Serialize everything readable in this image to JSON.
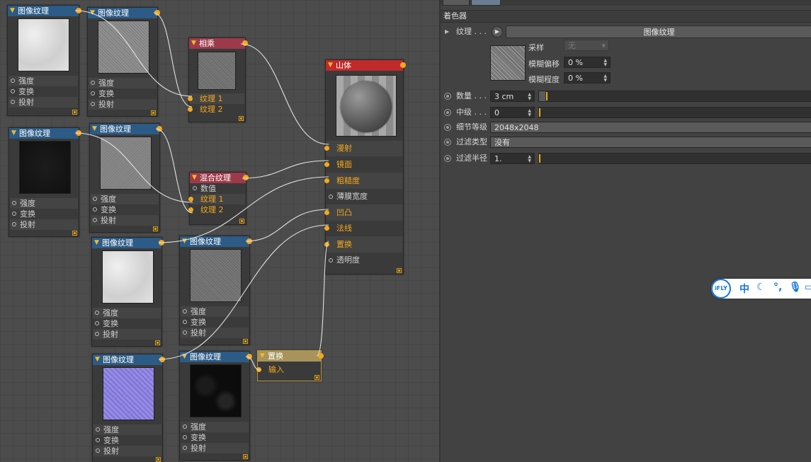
{
  "node_editor": {
    "nodes": {
      "tex_a": {
        "title": "图像纹理",
        "ports": [
          "强度",
          "变换",
          "投射"
        ]
      },
      "tex_b": {
        "title": "图像纹理",
        "ports": [
          "强度",
          "变换",
          "投射"
        ]
      },
      "multiply": {
        "title": "相乘",
        "ports": [
          "纹理 1",
          "纹理 2"
        ]
      },
      "tex_c": {
        "title": "图像纹理",
        "ports": [
          "强度",
          "变换",
          "投射"
        ]
      },
      "tex_d": {
        "title": "图像纹理",
        "ports": [
          "强度",
          "变换",
          "投射"
        ]
      },
      "mix": {
        "title": "混合纹理",
        "ports": [
          "数值",
          "纹理 1",
          "纹理 2"
        ]
      },
      "tex_e": {
        "title": "图像纹理",
        "ports": [
          "强度",
          "变换",
          "投射"
        ]
      },
      "tex_f": {
        "title": "图像纹理",
        "ports": [
          "强度",
          "变换",
          "投射"
        ]
      },
      "tex_g": {
        "title": "图像纹理",
        "ports": [
          "强度",
          "变换",
          "投射"
        ]
      },
      "tex_h": {
        "title": "图像纹理",
        "ports": [
          "强度",
          "变换",
          "投射"
        ]
      },
      "displace": {
        "title": "置换",
        "ports": [
          "输入"
        ]
      },
      "material": {
        "title": "山体",
        "ports": [
          "漫射",
          "镜面",
          "粗糙度",
          "薄膜宽度",
          "凹凸",
          "法线",
          "置换",
          "透明度"
        ]
      }
    }
  },
  "panel": {
    "section_title": "着色器",
    "texture": {
      "label": "纹理 . . .",
      "button": "图像纹理"
    },
    "sampling": {
      "label": "采样",
      "value": "无"
    },
    "blur_offset": {
      "label": "模糊偏移",
      "value": "0 %"
    },
    "blur_scale": {
      "label": "模糊程度",
      "value": "0 %"
    },
    "amount": {
      "label": "数量 . . .",
      "value": "3 cm"
    },
    "midlevel": {
      "label": "中级 . . .",
      "value": "0"
    },
    "subdivision": {
      "label": "细节等级",
      "value": "2048x2048"
    },
    "filter_type": {
      "label": "过滤类型",
      "value": "没有"
    },
    "filter_radius": {
      "label": "过滤半径",
      "value": "1."
    }
  },
  "ime": {
    "brand": "iFLY",
    "lang": "中"
  },
  "colors": {
    "accent": "#f3a81c",
    "texture_header": "#2b5b86",
    "op_header": "#9c3a4a",
    "material_header": "#c12a2a",
    "displace_header": "#a8945a"
  }
}
